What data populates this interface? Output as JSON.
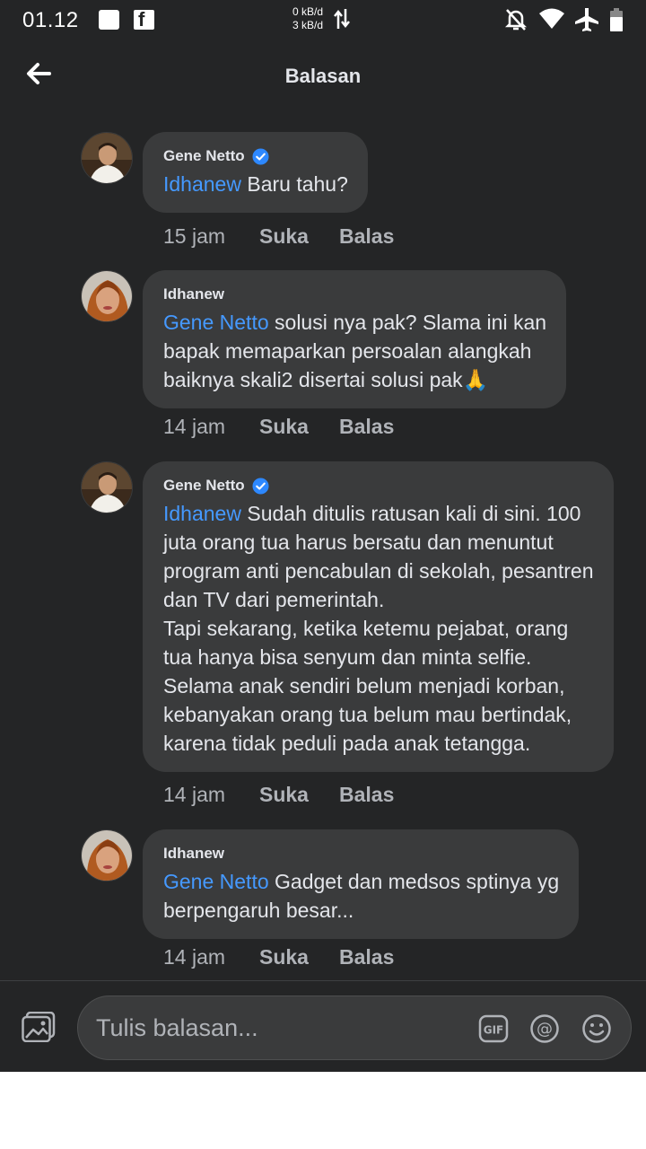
{
  "status_bar": {
    "time": "01.12",
    "net_down": "0 kB/d",
    "net_up": "3 kB/d",
    "icons": [
      "notification-square-icon",
      "facebook-icon",
      "data-arrows-icon",
      "mute-bell-icon",
      "wifi-icon",
      "airplane-icon",
      "battery-icon"
    ]
  },
  "header": {
    "title": "Balasan",
    "back_icon": "arrow-left-icon"
  },
  "comments": [
    {
      "author": "Gene Netto",
      "verified": true,
      "mention": "Idhanew",
      "text": " Baru tahu?",
      "time": "15 jam",
      "like": "Suka",
      "reply": "Balas"
    },
    {
      "author": "Idhanew",
      "verified": false,
      "mention": "Gene Netto",
      "text": " solusi nya pak? Slama ini kan\nbapak memaparkan persoalan alangkah\nbaiknya skali2 disertai solusi pak🙏",
      "time": "14 jam",
      "like": "Suka",
      "reply": "Balas"
    },
    {
      "author": "Gene Netto",
      "verified": true,
      "mention": "Idhanew",
      "text": " Sudah ditulis ratusan kali di sini. 100\njuta orang tua harus bersatu dan menuntut\nprogram anti pencabulan di sekolah, pesantren\ndan TV dari pemerintah.\nTapi sekarang, ketika ketemu pejabat, orang\ntua hanya bisa senyum dan minta selfie.\nSelama anak sendiri belum menjadi korban,\nkebanyakan orang tua belum mau bertindak,\nkarena tidak peduli pada anak tetangga.",
      "time": "14 jam",
      "like": "Suka",
      "reply": "Balas"
    },
    {
      "author": "Idhanew",
      "verified": false,
      "mention": "Gene Netto",
      "text": " Gadget dan medsos sptinya yg\nberpengaruh besar...",
      "time": "14 jam",
      "like": "Suka",
      "reply": "Balas"
    }
  ],
  "composer": {
    "placeholder": "Tulis balasan...",
    "icons": [
      "photo-icon",
      "gif-icon",
      "mention-icon",
      "emoji-icon"
    ]
  },
  "colors": {
    "background": "#242526",
    "bubble": "#3a3b3c",
    "mention": "#4599ff",
    "verified": "#2d88ff",
    "secondary_text": "#b0b3b8"
  }
}
